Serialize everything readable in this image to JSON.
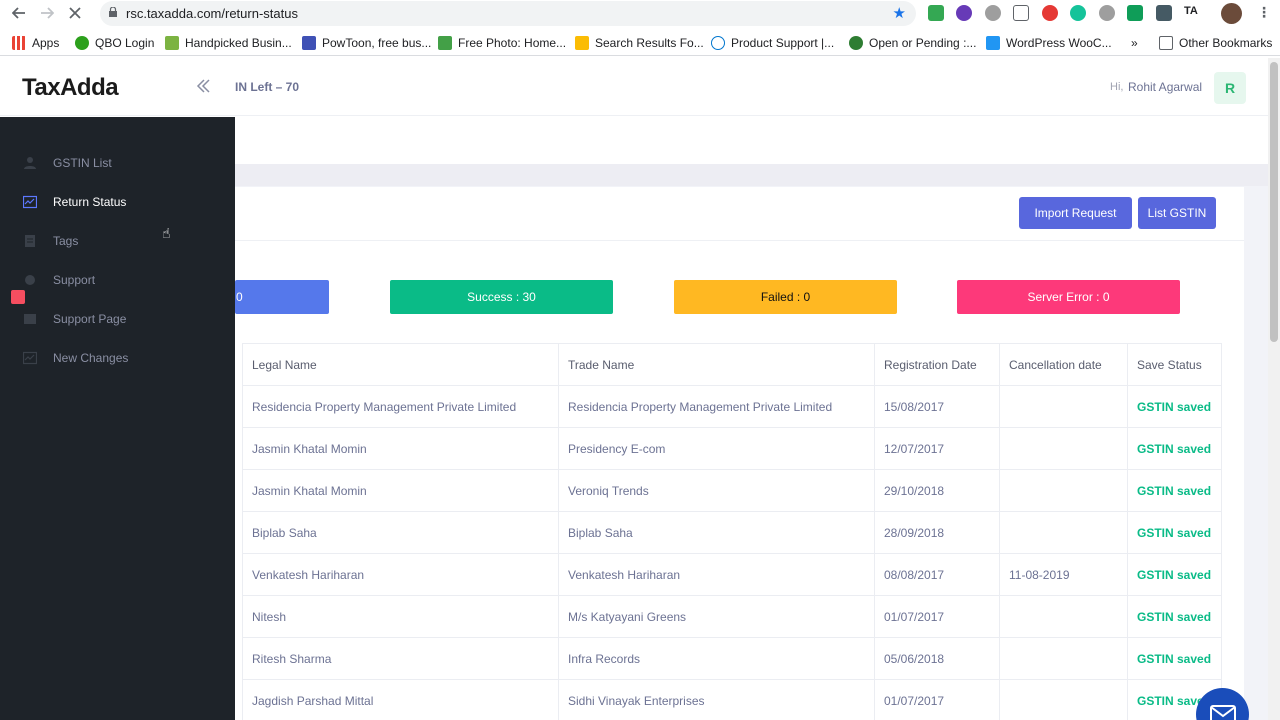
{
  "browser": {
    "url": "rsc.taxadda.com/return-status",
    "bookmarks": [
      {
        "label": "Apps",
        "icon": "apps-grid-icon",
        "color": "#4285f4"
      },
      {
        "label": "QBO Login",
        "icon": "quickbooks-icon",
        "color": "#2ca01c"
      },
      {
        "label": "Handpicked Busin...",
        "icon": "tag-icon",
        "color": "#7cb342"
      },
      {
        "label": "PowToon, free bus...",
        "icon": "powtoon-icon",
        "color": "#3f51b5"
      },
      {
        "label": "Free Photo: Home...",
        "icon": "px-icon",
        "color": "#43a047"
      },
      {
        "label": "Search Results Fo...",
        "icon": "drive-icon",
        "color": "#fbbc04"
      },
      {
        "label": "Product Support |...",
        "icon": "dell-icon",
        "color": "#0076ce"
      },
      {
        "label": "Open or Pending :...",
        "icon": "freshdesk-icon",
        "color": "#2e7d32"
      },
      {
        "label": "WordPress WooC...",
        "icon": "woo-icon",
        "color": "#2196f3"
      }
    ],
    "other_bookmarks": "Other Bookmarks",
    "more": "»"
  },
  "header": {
    "logo": "TaxAdda",
    "credits": "IN Left – 70",
    "greeting": "Hi,",
    "username": "Rohit Agarwal",
    "avatar_letter": "R"
  },
  "sidebar": {
    "items": [
      {
        "label": "GSTIN List",
        "icon": "user-icon"
      },
      {
        "label": "Return Status",
        "icon": "chart-icon"
      },
      {
        "label": "Tags",
        "icon": "document-icon"
      },
      {
        "label": "Support",
        "icon": "support-icon"
      },
      {
        "label": "Support Page",
        "icon": "support-page-icon"
      },
      {
        "label": "New Changes",
        "icon": "changes-icon"
      }
    ]
  },
  "actions": {
    "import_request": "Import Request",
    "list_gstin": "List GSTIN"
  },
  "stats": {
    "total": "0",
    "success": "Success : 30",
    "failed": "Failed : 0",
    "server_error": "Server Error : 0"
  },
  "table": {
    "headers": [
      "Legal Name",
      "Trade Name",
      "Registration Date",
      "Cancellation date",
      "Save Status"
    ],
    "rows": [
      [
        "Residencia Property Management Private Limited",
        "Residencia Property Management Private Limited",
        "15/08/2017",
        "",
        "GSTIN saved"
      ],
      [
        "Jasmin Khatal Momin",
        "Presidency E-com",
        "12/07/2017",
        "",
        "GSTIN saved"
      ],
      [
        "Jasmin Khatal Momin",
        "Veroniq Trends",
        "29/10/2018",
        "",
        "GSTIN saved"
      ],
      [
        "Biplab Saha",
        "Biplab Saha",
        "28/09/2018",
        "",
        "GSTIN saved"
      ],
      [
        "Venkatesh Hariharan",
        "Venkatesh Hariharan",
        "08/08/2017",
        "11-08-2019",
        "GSTIN saved"
      ],
      [
        "Nitesh",
        "M/s Katyayani Greens",
        "01/07/2017",
        "",
        "GSTIN saved"
      ],
      [
        "Ritesh Sharma",
        "Infra Records",
        "05/06/2018",
        "",
        "GSTIN saved"
      ],
      [
        "Jagdish Parshad Mittal",
        "Sidhi Vinayak Enterprises",
        "01/07/2017",
        "",
        "GSTIN saved"
      ]
    ]
  },
  "colors": {
    "primary": "#5867dd",
    "success": "#0abb87",
    "warning": "#ffb822",
    "danger": "#fd397a",
    "sidebar": "#1e2329"
  }
}
